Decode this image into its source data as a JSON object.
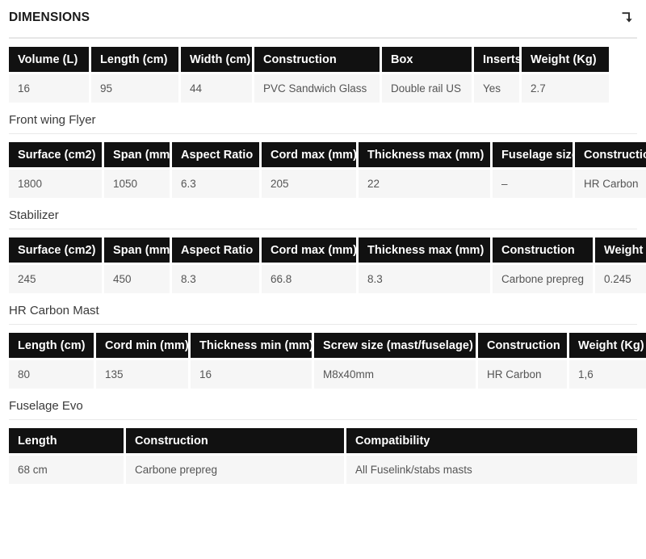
{
  "header": {
    "title": "DIMENSIONS",
    "collapse_icon": "arrow-turn-down-icon"
  },
  "sections": [
    {
      "id": "dimensions-main",
      "title": "",
      "show_title": false,
      "columns": [
        "Volume (L)",
        "Length (cm)",
        "Width (cm)",
        "Construction",
        "Box",
        "Inserts",
        "Weight (Kg)"
      ],
      "widths": [
        99,
        108,
        88,
        155,
        111,
        56,
        108
      ],
      "values": [
        "16",
        "95",
        "44",
        "PVC Sandwich Glass",
        "Double rail US",
        "Yes",
        "2.7"
      ]
    },
    {
      "id": "front-wing-flyer",
      "title": "Front wing Flyer",
      "show_title": true,
      "columns": [
        "Surface (cm2)",
        "Span (mm)",
        "Aspect Ratio",
        "Cord max (mm)",
        "Thickness max (mm)",
        "Fuselage size",
        "Construction"
      ],
      "widths": [
        115,
        81,
        108,
        117,
        163,
        99,
        108
      ],
      "values": [
        "1800",
        "1050",
        "6.3",
        "205",
        "22",
        "–",
        "HR Carbon"
      ]
    },
    {
      "id": "stabilizer",
      "title": "Stabilizer",
      "show_title": true,
      "columns": [
        "Surface (cm2)",
        "Span (mm)",
        "Aspect Ratio",
        "Cord max (mm)",
        "Thickness max (mm)",
        "Construction",
        "Weight (Kg)"
      ],
      "widths": [
        115,
        81,
        108,
        117,
        163,
        124,
        108
      ],
      "values": [
        "245",
        "450",
        "8.3",
        "66.8",
        "8.3",
        "Carbone prepreg",
        "0.245"
      ]
    },
    {
      "id": "hr-carbon-mast",
      "title": "HR Carbon Mast",
      "show_title": true,
      "columns": [
        "Length (cm)",
        "Cord min (mm)",
        "Thickness min (mm)",
        "Screw size (mast/fuselage)",
        "Construction",
        "Weight (Kg)"
      ],
      "widths": [
        105,
        114,
        150,
        200,
        110,
        108
      ],
      "values": [
        "80",
        "135",
        "16",
        "M8x40mm",
        "HR Carbon",
        "1,6"
      ]
    },
    {
      "id": "fuselage-evo",
      "title": "Fuselage Evo",
      "show_title": true,
      "columns": [
        "Length",
        "Construction",
        "Compatibility"
      ],
      "widths": [
        142,
        270,
        360
      ],
      "values": [
        "68 cm",
        "Carbone prepreg",
        "All Fuselink/stabs masts"
      ]
    }
  ],
  "colors": {
    "header_cell_bg": "#111111",
    "header_cell_text": "#ffffff",
    "body_cell_bg": "#f6f6f6",
    "body_cell_text": "#555555",
    "page_bg": "#ffffff",
    "rule": "#e6e6e6"
  }
}
